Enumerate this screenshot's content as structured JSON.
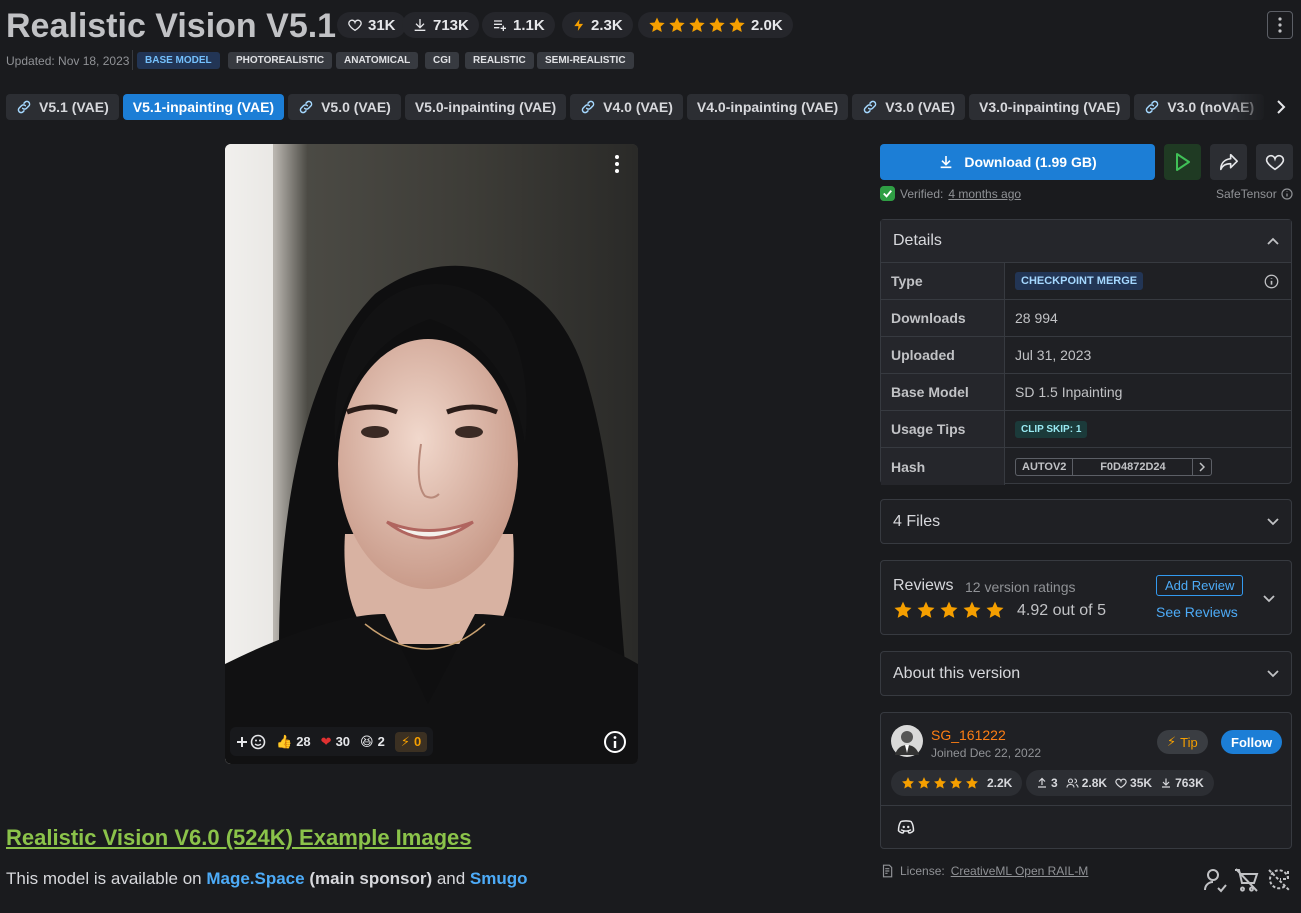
{
  "header": {
    "title": "Realistic Vision V5.1",
    "stats": {
      "likes": "31K",
      "downloads": "713K",
      "collections": "1.1K",
      "buzz": "2.3K",
      "rating_count": "2.0K"
    },
    "updated": "Updated: Nov 18, 2023",
    "tags": [
      "BASE MODEL",
      "PHOTOREALISTIC",
      "ANATOMICAL",
      "CGI",
      "REALISTIC",
      "SEMI-REALISTIC"
    ]
  },
  "versions": [
    {
      "label": "V5.1 (VAE)",
      "linked": true,
      "active": false
    },
    {
      "label": "V5.1-inpainting (VAE)",
      "linked": false,
      "active": true
    },
    {
      "label": "V5.0 (VAE)",
      "linked": true,
      "active": false
    },
    {
      "label": "V5.0-inpainting (VAE)",
      "linked": false,
      "active": false
    },
    {
      "label": "V4.0 (VAE)",
      "linked": true,
      "active": false
    },
    {
      "label": "V4.0-inpainting (VAE)",
      "linked": false,
      "active": false
    },
    {
      "label": "V3.0 (VAE)",
      "linked": true,
      "active": false
    },
    {
      "label": "V3.0-inpainting (VAE)",
      "linked": false,
      "active": false
    },
    {
      "label": "V3.0 (noVAE)",
      "linked": true,
      "active": false
    },
    {
      "label": "V3.0-inpainting (noVAE)",
      "linked": false,
      "active": false
    }
  ],
  "image": {
    "reactions": {
      "like": "28",
      "heart": "30",
      "laugh": "2",
      "buzz": "0"
    }
  },
  "content": {
    "example_link": "Realistic Vision V6.0 (524K) Example Images",
    "avail_prefix": "This model is available on ",
    "avail_link1": "Mage.Space",
    "avail_mid": " (main sponsor)",
    "avail_and": " and ",
    "avail_link2": "Smugo"
  },
  "sidebar": {
    "download_label": "Download (1.99 GB)",
    "verified_prefix": "Verified:",
    "verified_when": "4 months ago",
    "file_format": "SafeTensor",
    "details_title": "Details",
    "details": {
      "type_label": "Type",
      "type_value": "CHECKPOINT MERGE",
      "downloads_label": "Downloads",
      "downloads_value": "28 994",
      "uploaded_label": "Uploaded",
      "uploaded_value": "Jul 31, 2023",
      "base_label": "Base Model",
      "base_value": "SD 1.5 Inpainting",
      "tips_label": "Usage Tips",
      "tips_value": "CLIP SKIP: 1",
      "hash_label": "Hash",
      "hash_type": "AUTOV2",
      "hash_value": "F0D4872D24"
    },
    "files_title": "4 Files",
    "reviews": {
      "title": "Reviews",
      "count": "12 version ratings",
      "score": "4.92 out of 5",
      "add_label": "Add Review",
      "see_label": "See Reviews"
    },
    "about_title": "About this version",
    "creator": {
      "name": "SG_161222",
      "joined": "Joined Dec 22, 2022",
      "tip_label": "Tip",
      "follow_label": "Follow",
      "rating": "2.2K",
      "uploads": "3",
      "followers": "2.8K",
      "likes": "35K",
      "downloads": "763K"
    },
    "license_prefix": "License:",
    "license_name": "CreativeML Open RAIL-M"
  },
  "colors": {
    "background": "#1a1b1e",
    "accent": "#1c7ed6",
    "star": "#f59f00",
    "link_green": "#8bc34a",
    "creator_orange": "#fd7e14"
  }
}
